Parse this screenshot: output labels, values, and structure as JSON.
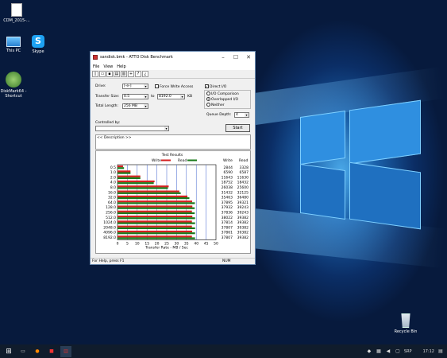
{
  "desktop": {
    "icons": [
      {
        "label": "CDM_2015-..."
      },
      {
        "label": "This PC"
      },
      {
        "label": "Skype"
      },
      {
        "label": "DiskMark64 - Shortcut"
      },
      {
        "label": "Recycle Bin"
      }
    ]
  },
  "window": {
    "title": "sandisk.bmk - ATTO Disk Benchmark",
    "menu": [
      "File",
      "View",
      "Help"
    ],
    "drive_label": "Drive:",
    "drive_value": "[-e-]",
    "force_write_label": "Force Write Access",
    "direct_io_label": "Direct I/O",
    "transfer_size_label": "Transfer Size:",
    "transfer_from": "0.5",
    "to_label": "to",
    "transfer_to": "8192.0",
    "kb_label": "KB",
    "total_length_label": "Total Length:",
    "total_length_value": "256 MB",
    "io_comparison_label": "I/O Comparison",
    "overlapped_io_label": "Overlapped I/O",
    "neither_label": "Neither",
    "queue_depth_label": "Queue Depth:",
    "queue_depth_value": "4",
    "controlled_by_label": "Controlled by:",
    "start_label": "Start",
    "description_text": "<< Description >>",
    "status_text": "For Help, press F1",
    "num_indicator": "NUM"
  },
  "chart_data": {
    "type": "bar",
    "title": "Test Results",
    "xlabel": "Transfer Rate - MB / Sec",
    "xlim": [
      0,
      50
    ],
    "xticks": [
      "0",
      "5",
      "10",
      "15",
      "20",
      "25",
      "30",
      "35",
      "40",
      "45",
      "50"
    ],
    "legend": {
      "write": "Write",
      "read": "Read",
      "position": "top"
    },
    "column_headers": {
      "write": "Write",
      "read": "Read"
    },
    "categories": [
      "0.5",
      "1.0",
      "2.0",
      "4.0",
      "8.0",
      "16.0",
      "32.0",
      "64.0",
      "128.0",
      "256.0",
      "512.0",
      "1024.0",
      "2048.0",
      "4096.0",
      "8192.0"
    ],
    "series": [
      {
        "name": "Write",
        "color": "#d42020",
        "values": [
          2.8,
          6.6,
          11.6,
          18.8,
          26.0,
          31.4,
          35.5,
          37.9,
          38.0,
          37.8,
          38.0,
          37.8,
          37.8,
          37.9,
          37.8
        ]
      },
      {
        "name": "Read",
        "color": "#1a7a1a",
        "values": [
          3.3,
          6.6,
          11.6,
          18.4,
          25.6,
          32.1,
          36.5,
          39.3,
          39.2,
          39.2,
          39.4,
          39.4,
          39.4,
          39.4,
          39.4
        ]
      }
    ],
    "write_values": [
      "2844",
      "6590",
      "11643",
      "18752",
      "26038",
      "31432",
      "35463",
      "37895",
      "37932",
      "37836",
      "38022",
      "37814",
      "37807",
      "37861",
      "37807"
    ],
    "read_values": [
      "3328",
      "6587",
      "11630",
      "18432",
      "25600",
      "32125",
      "36480",
      "39321",
      "39243",
      "39243",
      "39382",
      "39382",
      "39382",
      "39382",
      "39382"
    ]
  },
  "taskbar": {
    "lang": "SRP",
    "time": "17:12"
  }
}
